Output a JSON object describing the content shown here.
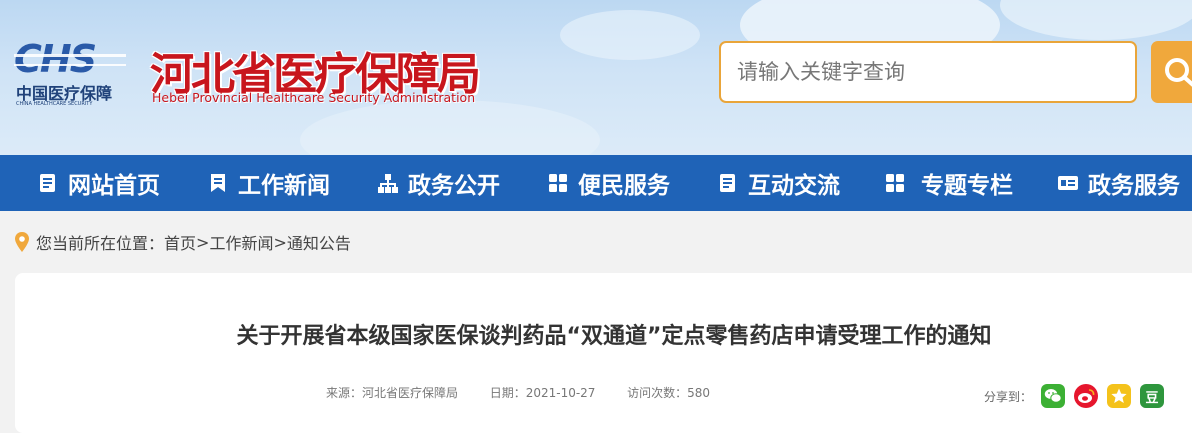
{
  "colors": {
    "brand_red": "#c8161d",
    "nav_blue": "#1f63b7",
    "search_orange": "#f0a83c",
    "logo_blue": "#2a5aa8"
  },
  "header": {
    "logo_mark": "CHS",
    "logo_cn": "中国医疗保障",
    "logo_en": "CHINA HEALTHCARE SECURITY",
    "title": "河北省医疗保障局",
    "subtitle": "Hebei Provincial Healthcare Security Administration",
    "search_placeholder": "请输入关键字查询",
    "search_icon": "search-icon"
  },
  "nav": {
    "items": [
      {
        "label": "网站首页",
        "icon": "document-list-icon"
      },
      {
        "label": "工作新闻",
        "icon": "bookmark-icon"
      },
      {
        "label": "政务公开",
        "icon": "sitemap-icon"
      },
      {
        "label": "便民服务",
        "icon": "grid-icon"
      },
      {
        "label": "互动交流",
        "icon": "document-list-icon"
      },
      {
        "label": "专题专栏",
        "icon": "grid-icon"
      },
      {
        "label": "政务服务",
        "icon": "id-card-icon"
      }
    ]
  },
  "breadcrumb": {
    "prefix": "您当前所在位置：",
    "items": [
      "首页",
      "工作新闻",
      "通知公告"
    ],
    "separator": ">"
  },
  "article": {
    "title": "关于开展省本级国家医保谈判药品“双通道”定点零售药店申请受理工作的通知",
    "source_label": "来源：",
    "source": "河北省医疗保障局",
    "date_label": "日期：",
    "date": "2021-10-27",
    "visits_label": "访问次数：",
    "visits": "580",
    "share_label": "分享到：",
    "share_targets": [
      {
        "name": "wechat",
        "color": "#3cb034"
      },
      {
        "name": "weibo",
        "color": "#e6162d"
      },
      {
        "name": "qzone",
        "color": "#f4c21b"
      },
      {
        "name": "douban",
        "color": "#2e963d",
        "glyph": "豆"
      }
    ]
  }
}
